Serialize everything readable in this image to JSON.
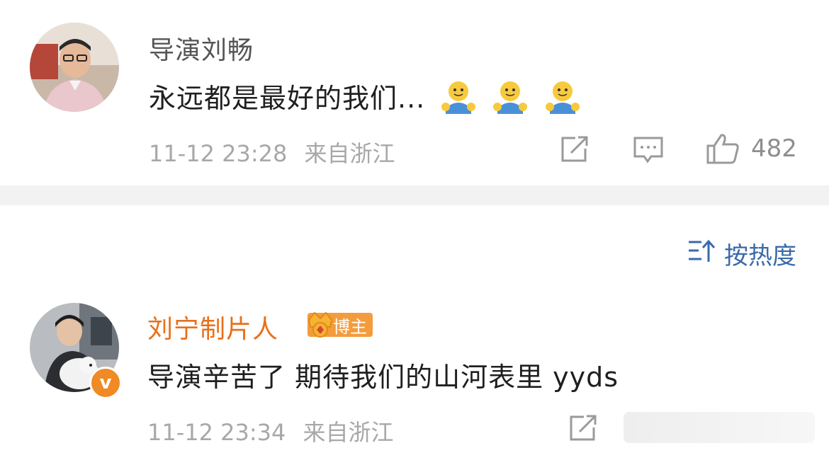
{
  "comments": [
    {
      "author": "导演刘畅",
      "text": "永远都是最好的我们...",
      "emoji": [
        "hug-emoji",
        "hug-emoji",
        "hug-emoji"
      ],
      "time": "11-12 23:28",
      "location": "来自浙江",
      "likes": "482",
      "name_color": "#555555"
    },
    {
      "author": "刘宁制片人",
      "badge": "博主",
      "text": "导演辛苦了 期待我们的山河表里 yyds",
      "time": "11-12 23:34",
      "location": "来自浙江",
      "name_color": "#e8701a"
    }
  ],
  "sort": {
    "label": "按热度"
  },
  "colors": {
    "accent_blue": "#3b6aa8",
    "orange": "#f08a24",
    "gray_text": "#a8a8a8"
  }
}
